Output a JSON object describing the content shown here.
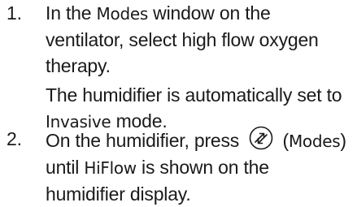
{
  "steps": [
    {
      "number": "1.",
      "text_before": "In the ",
      "ui_term": "Modes",
      "text_after": " window on the ventilator, select high flow oxygen therapy.",
      "note_before": "The humidifier is automatically set to ",
      "note_term": "Invasive",
      "note_after": " mode."
    },
    {
      "number": "2.",
      "text_before": "On the humidifier, press ",
      "icon": "modes-button-icon",
      "paren_open": " (",
      "ui_term": "Modes",
      "paren_close": ")",
      "text_middle": " until ",
      "ui_term_2": "HiFlow",
      "text_after": " is shown on the humidifier display."
    }
  ]
}
